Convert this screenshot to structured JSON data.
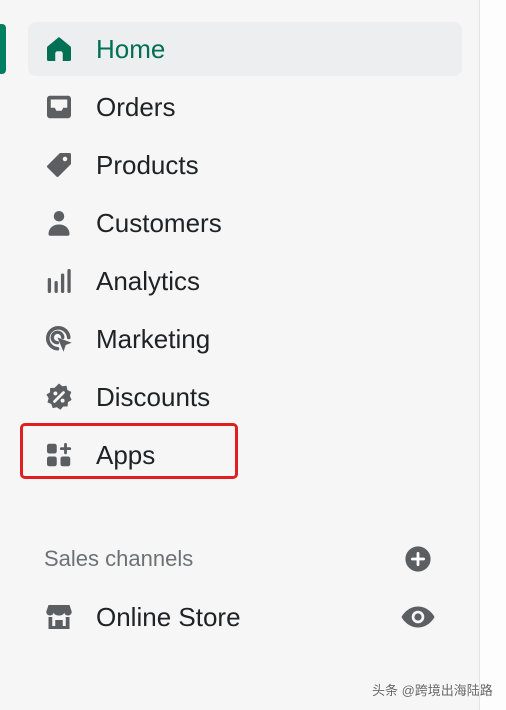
{
  "colors": {
    "accent": "#008060",
    "active_text": "#007055",
    "icon": "#5c5f62",
    "highlight": "#e02020"
  },
  "nav": {
    "items": [
      {
        "label": "Home",
        "icon": "home-icon",
        "active": true
      },
      {
        "label": "Orders",
        "icon": "orders-icon"
      },
      {
        "label": "Products",
        "icon": "tag-icon"
      },
      {
        "label": "Customers",
        "icon": "person-icon"
      },
      {
        "label": "Analytics",
        "icon": "bar-chart-icon"
      },
      {
        "label": "Marketing",
        "icon": "target-icon"
      },
      {
        "label": "Discounts",
        "icon": "discount-icon"
      },
      {
        "label": "Apps",
        "icon": "apps-icon",
        "highlighted": true
      }
    ]
  },
  "sales_channels": {
    "header": "Sales channels",
    "add_icon": "plus-circle-icon",
    "items": [
      {
        "label": "Online Store",
        "icon": "store-icon",
        "action_icon": "eye-icon"
      }
    ]
  },
  "watermark": "头条 @跨境出海陆路"
}
